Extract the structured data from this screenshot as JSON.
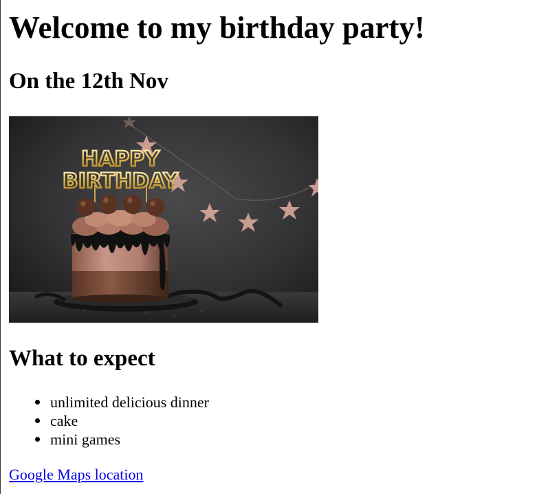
{
  "heading": "Welcome to my birthday party!",
  "date": "On the 12th Nov",
  "photo": {
    "alt": "Chocolate birthday cake with Happy Birthday topper",
    "topper_line1": "HAPPY",
    "topper_line2": "BIRTHDAY"
  },
  "expect": {
    "title": "What to expect",
    "items": [
      "unlimited delicious dinner",
      "cake",
      "mini games"
    ]
  },
  "link": {
    "label": "Google Maps location",
    "color": "#0000ee"
  }
}
